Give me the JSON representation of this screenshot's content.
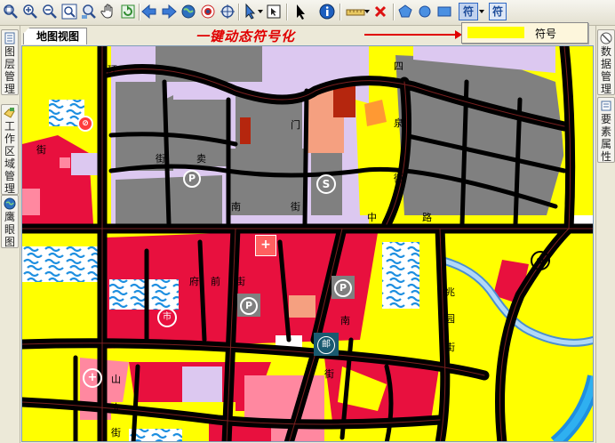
{
  "toolbar": {
    "buttons": [
      {
        "name": "zoom-all-button",
        "icon": "zoom-all-icon"
      },
      {
        "name": "zoom-in-button",
        "icon": "zoom-in-icon"
      },
      {
        "name": "zoom-out-button",
        "icon": "zoom-out-icon"
      },
      {
        "name": "zoom-fit-button",
        "icon": "zoom-fit-icon"
      },
      {
        "name": "zoom-window-button",
        "icon": "zoom-window-icon"
      },
      {
        "name": "pan-button",
        "icon": "hand-icon"
      },
      {
        "name": "refresh-button",
        "icon": "refresh-icon"
      },
      {
        "name": "back-button",
        "icon": "arrow-left-icon"
      },
      {
        "name": "forward-button",
        "icon": "arrow-right-icon"
      },
      {
        "name": "full-extent-button",
        "icon": "globe-icon"
      },
      {
        "name": "identify-button",
        "icon": "target-icon"
      },
      {
        "name": "center-button",
        "icon": "crosshair-icon"
      },
      {
        "name": "select-arrow-button",
        "icon": "cursor-icon"
      },
      {
        "name": "clear-select-button",
        "icon": "select-box-icon"
      },
      {
        "name": "pointer-button",
        "icon": "pointer-icon"
      },
      {
        "name": "info-button",
        "icon": "info-icon"
      },
      {
        "name": "measure-button",
        "icon": "ruler-icon"
      },
      {
        "name": "delete-button",
        "icon": "red-x-icon"
      },
      {
        "name": "polygon-button",
        "icon": "pentagon-icon"
      },
      {
        "name": "circle-button",
        "icon": "circle-icon"
      },
      {
        "name": "rectangle-button",
        "icon": "rectangle-icon"
      }
    ],
    "symbol_button_label": "符",
    "symbol_button2_label": "符"
  },
  "symbol_popup": {
    "label": "符号",
    "swatch_color": "#ffff00"
  },
  "tab_label": "地图视图",
  "caption": "一键动态符号化",
  "left_panel": [
    {
      "label": "图层管理",
      "icon": "layers-icon"
    },
    {
      "label": "工作区域管理",
      "icon": "workspace-icon"
    },
    {
      "label": "鹰眼图",
      "icon": "eagle-eye-icon"
    }
  ],
  "right_panel": [
    {
      "label": "数据管理",
      "icon": "data-icon"
    },
    {
      "label": "要素属性",
      "icon": "properties-icon"
    }
  ],
  "map_labels": [
    {
      "text": "街",
      "kind": "street"
    },
    {
      "text": "环",
      "kind": "street"
    },
    {
      "text": "南",
      "kind": "street"
    },
    {
      "text": "门",
      "kind": "street"
    },
    {
      "text": "街",
      "kind": "street"
    },
    {
      "text": "四",
      "kind": "street"
    },
    {
      "text": "泉",
      "kind": "street"
    },
    {
      "text": "街",
      "kind": "street"
    },
    {
      "text": "中",
      "kind": "street"
    },
    {
      "text": "路",
      "kind": "street"
    },
    {
      "text": "兆",
      "kind": "street"
    },
    {
      "text": "园",
      "kind": "street"
    },
    {
      "text": "街",
      "kind": "street"
    },
    {
      "text": "山",
      "kind": "street"
    },
    {
      "text": "大",
      "kind": "street"
    },
    {
      "text": "街",
      "kind": "street"
    },
    {
      "text": "南",
      "kind": "street"
    },
    {
      "text": "街",
      "kind": "street"
    },
    {
      "text": "府",
      "kind": "street"
    },
    {
      "text": "前",
      "kind": "street"
    },
    {
      "text": "街",
      "kind": "street"
    },
    {
      "text": "卖",
      "kind": "street"
    },
    {
      "text": "街",
      "kind": "street"
    }
  ],
  "map_icons": [
    {
      "name": "parking-icon",
      "glyph": "P"
    },
    {
      "name": "gas-station-icon",
      "glyph": "S"
    },
    {
      "name": "hospital-icon",
      "glyph": "+"
    },
    {
      "name": "parking-icon",
      "glyph": "P"
    },
    {
      "name": "parking-icon",
      "glyph": "P"
    },
    {
      "name": "market-icon",
      "glyph": "市"
    },
    {
      "name": "post-office-icon",
      "glyph": "邮"
    },
    {
      "name": "hospital-icon",
      "glyph": "+"
    },
    {
      "name": "recycle-icon",
      "glyph": "↺"
    },
    {
      "name": "no-entry-icon",
      "glyph": "⊘"
    }
  ],
  "colors": {
    "road": "#000000",
    "road_center": "#7a1f1f",
    "residential": "#ffff00",
    "commercial": "#e8103e",
    "block": "#808080",
    "water": "#1e8fe0",
    "pink": "#ff88a0",
    "lilac": "#dcc8f0",
    "orange": "#ff9933",
    "salmon": "#f5a080",
    "teal": "#1a5a70"
  }
}
